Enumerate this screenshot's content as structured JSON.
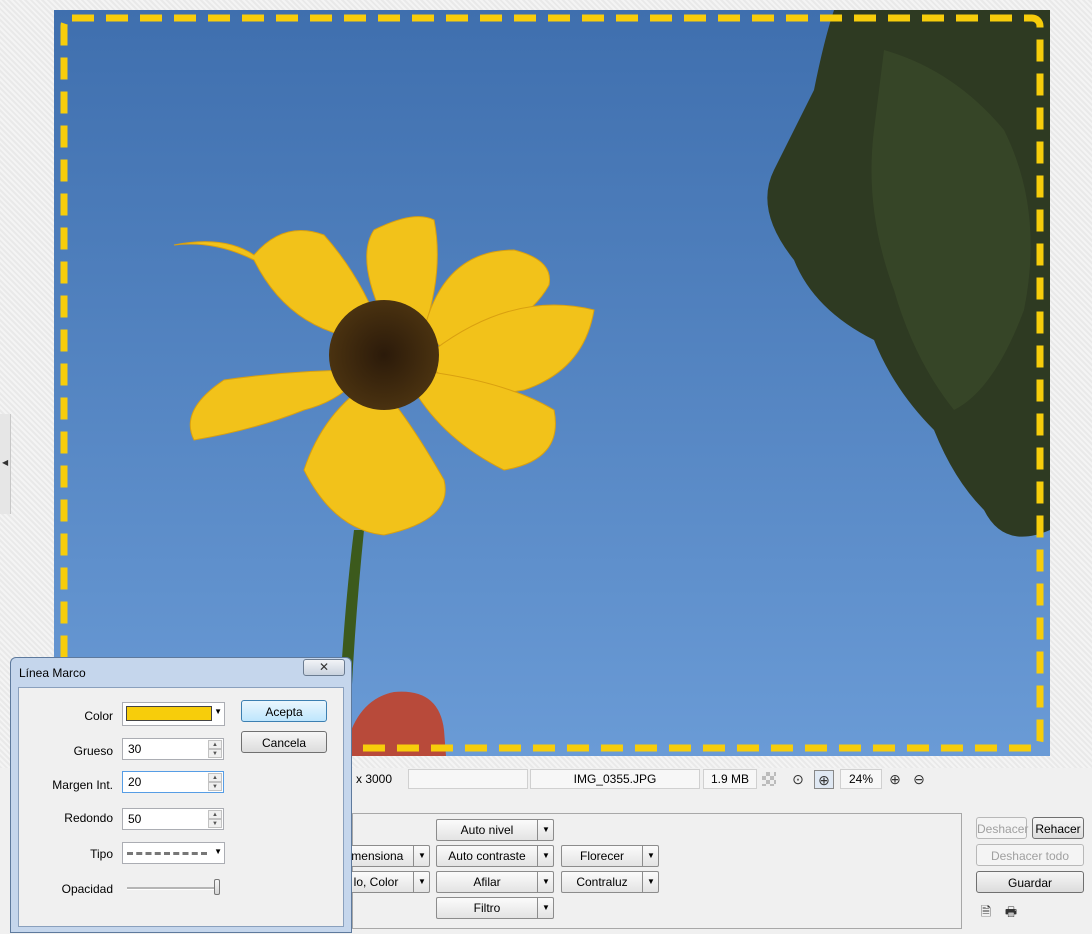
{
  "status_bar": {
    "dimensions": "x 3000",
    "filename": "IMG_0355.JPG",
    "filesize": "1.9 MB",
    "zoom": "24%",
    "icons": [
      "checker-icon",
      "fit-zoom-icon",
      "actual-zoom-icon",
      "zoom-in-icon",
      "zoom-out-icon"
    ]
  },
  "tools": {
    "col1": [
      "imensiona",
      "lo, Color"
    ],
    "col2": [
      "Auto nivel",
      "Auto contraste",
      "Afilar",
      "Filtro"
    ],
    "col3": [
      "Florecer",
      "Contraluz"
    ]
  },
  "history": {
    "undo": "Deshacer",
    "redo": "Rehacer",
    "undo_all": "Deshacer todo",
    "save": "Guardar"
  },
  "dialog": {
    "title": "Línea Marco",
    "close": "✕",
    "color_label": "Color",
    "color_value": "#f7cd0b",
    "thickness_label": "Grueso",
    "thickness_value": "30",
    "margin_label": "Margen Int.",
    "margin_value": "20",
    "rounded_label": "Redondo",
    "rounded_value": "50",
    "type_label": "Tipo",
    "opacity_label": "Opacidad",
    "opacity_level": 1.0,
    "ok": "Acepta",
    "cancel": "Cancela"
  },
  "colors": {
    "frame_dash": "#f7cd0b",
    "sky": "#4f7fbd"
  }
}
